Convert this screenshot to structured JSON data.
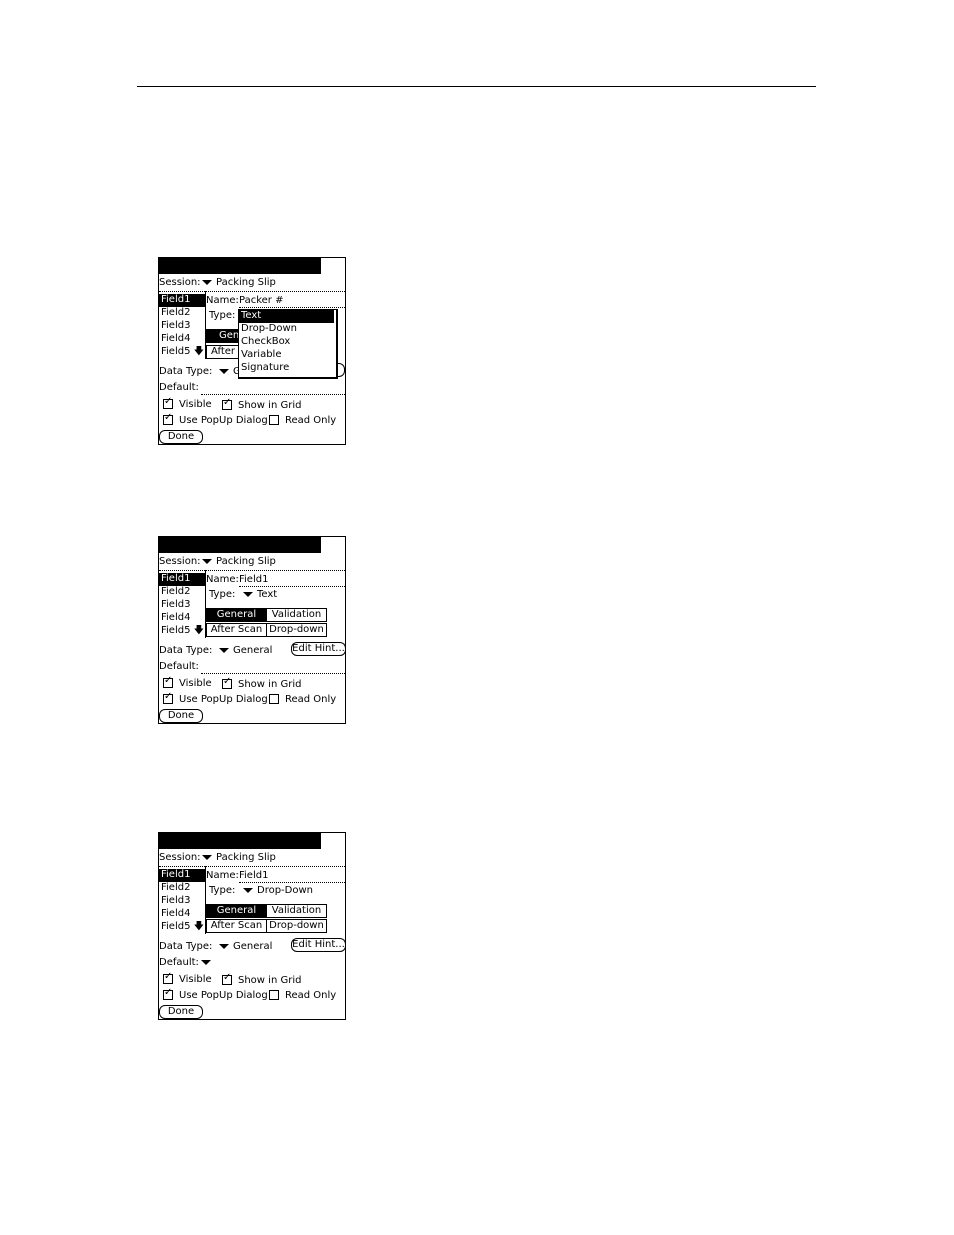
{
  "shots": [
    {
      "session_label": "Session:",
      "session_value": "Packing Slip",
      "fields": [
        "Field1",
        "Field2",
        "Field3",
        "Field4",
        "Field5"
      ],
      "name_label": "Name:",
      "name_value": "Packer #",
      "type_label": "Type:",
      "type_value": "",
      "tabs_partial": [
        "Gen",
        "After"
      ],
      "data_type_label": "Data Type:",
      "data_type_partial": "G",
      "default_label": "Default:",
      "visible_label": "Visible",
      "show_in_grid_label": "Show in Grid",
      "use_popup_label": "Use PopUp Dialog",
      "read_only_label": "Read Only",
      "done_label": "Done",
      "type_options": [
        "Text",
        "Drop-Down",
        "CheckBox",
        "Variable",
        "Signature"
      ],
      "type_selected_option": "Text"
    },
    {
      "session_label": "Session:",
      "session_value": "Packing Slip",
      "fields": [
        "Field1",
        "Field2",
        "Field3",
        "Field4",
        "Field5"
      ],
      "name_label": "Name:",
      "name_value": "Field1",
      "type_label": "Type:",
      "type_value": "Text",
      "tabs": [
        "General",
        "Validation",
        "After Scan",
        "Drop-down"
      ],
      "data_type_label": "Data Type:",
      "data_type_value": "General",
      "edit_hint_label": "Edit Hint...",
      "default_label": "Default:",
      "visible_label": "Visible",
      "show_in_grid_label": "Show in Grid",
      "use_popup_label": "Use PopUp Dialog",
      "read_only_label": "Read Only",
      "done_label": "Done"
    },
    {
      "session_label": "Session:",
      "session_value": "Packing Slip",
      "fields": [
        "Field1",
        "Field2",
        "Field3",
        "Field4",
        "Field5"
      ],
      "name_label": "Name:",
      "name_value": "Field1",
      "type_label": "Type:",
      "type_value": "Drop-Down",
      "tabs": [
        "General",
        "Validation",
        "After Scan",
        "Drop-down"
      ],
      "data_type_label": "Data Type:",
      "data_type_value": "General",
      "edit_hint_label": "Edit Hint...",
      "default_label": "Default:",
      "visible_label": "Visible",
      "show_in_grid_label": "Show in Grid",
      "use_popup_label": "Use PopUp Dialog",
      "read_only_label": "Read Only",
      "done_label": "Done"
    }
  ],
  "checkbox_states": {
    "visible": true,
    "show_in_grid": true,
    "use_popup": true,
    "read_only": false
  }
}
